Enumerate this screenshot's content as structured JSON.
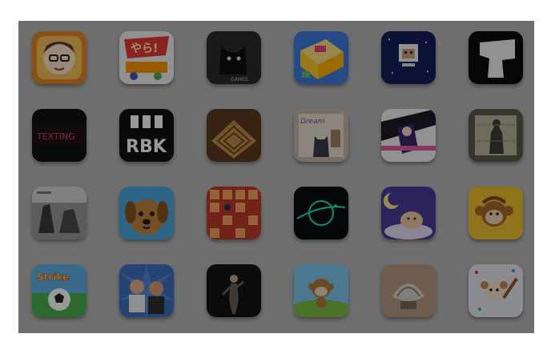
{
  "apps": [
    {
      "name": "avatar-boy",
      "label": ""
    },
    {
      "name": "yah-game",
      "label": "やら!"
    },
    {
      "name": "games-cat",
      "label": "GAMES"
    },
    {
      "name": "toy-box",
      "label": ""
    },
    {
      "name": "pixel-sheep",
      "label": ""
    },
    {
      "name": "white-shape",
      "label": ""
    },
    {
      "name": "dark-title",
      "label": "TEXTING"
    },
    {
      "name": "rbk-chess",
      "label": "RBK"
    },
    {
      "name": "maze-board",
      "label": ""
    },
    {
      "name": "dream-cat",
      "label": "Dream"
    },
    {
      "name": "anime-girl",
      "label": ""
    },
    {
      "name": "stone-man",
      "label": ""
    },
    {
      "name": "ruins",
      "label": ""
    },
    {
      "name": "dog-face",
      "label": ""
    },
    {
      "name": "grid-puzzle",
      "label": ""
    },
    {
      "name": "neon-planet",
      "label": ""
    },
    {
      "name": "moon-cat",
      "label": ""
    },
    {
      "name": "monkey-yellow",
      "label": ""
    },
    {
      "name": "soccer-strike",
      "label": "Strike"
    },
    {
      "name": "two-men",
      "label": ""
    },
    {
      "name": "dancer",
      "label": ""
    },
    {
      "name": "monkey-meadow",
      "label": ""
    },
    {
      "name": "glass-shell",
      "label": ""
    },
    {
      "name": "bat-monkey",
      "label": ""
    }
  ]
}
